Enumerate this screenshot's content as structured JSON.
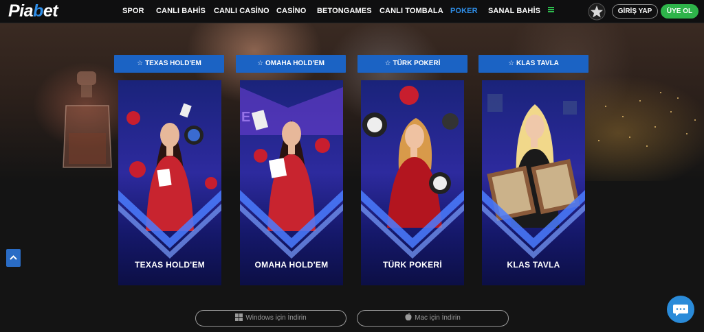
{
  "brand": {
    "logo_pre": "Pia",
    "logo_b": "b",
    "logo_post": "et"
  },
  "nav": {
    "items": [
      {
        "label": "SPOR"
      },
      {
        "label": "CANLI BAHİS"
      },
      {
        "label": "CANLI CASİNO"
      },
      {
        "label": "CASİNO"
      },
      {
        "label": "BETONGAMES"
      },
      {
        "label": "CANLI TOMBALA"
      },
      {
        "label": "POKER",
        "active": true
      },
      {
        "label": "SANAL BAHİS"
      }
    ],
    "menu_icon": "hamburger-icon",
    "login_label": "GİRİŞ YAP",
    "register_label": "ÜYE OL"
  },
  "tabs": [
    {
      "label": "TEXAS HOLD'EM"
    },
    {
      "label": "OMAHA HOLD'EM"
    },
    {
      "label": "TÜRK POKERİ"
    },
    {
      "label": "KLAS TAVLA"
    }
  ],
  "cards": [
    {
      "title": "TEXAS HOLD'EM"
    },
    {
      "title": "OMAHA HOLD'EM"
    },
    {
      "title": "TÜRK POKERİ"
    },
    {
      "title": "KLAS TAVLA"
    }
  ],
  "downloads": {
    "windows_label": "Windows için İndirin",
    "mac_label": "Mac için İndirin"
  },
  "colors": {
    "accent": "#1b63c4",
    "active_nav": "#2f8ee8",
    "register": "#2eb44a",
    "background": "#141414"
  }
}
